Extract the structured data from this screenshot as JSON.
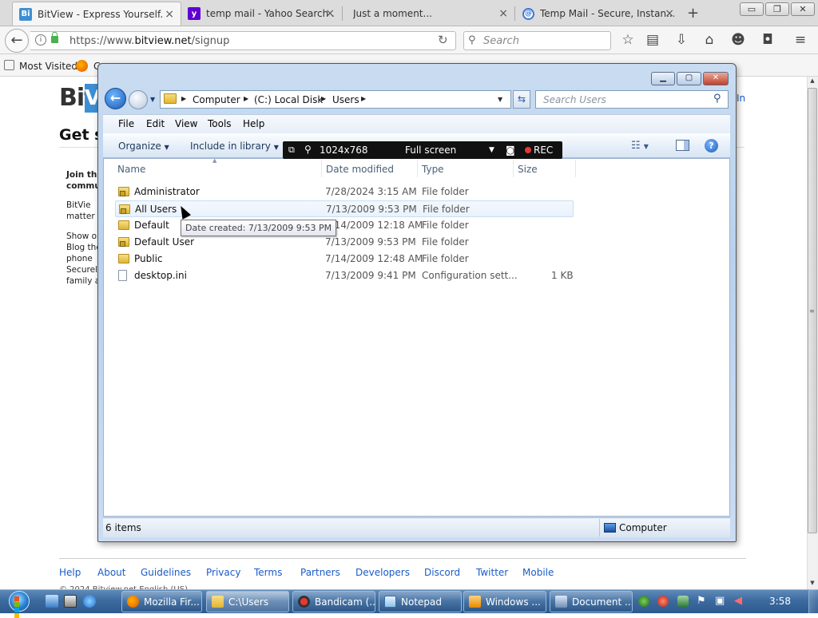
{
  "browser": {
    "tabs": [
      {
        "label": "BitView - Express Yourself.",
        "active": true
      },
      {
        "label": "temp mail - Yahoo Search ...",
        "active": false
      },
      {
        "label": "Just a moment...",
        "active": false
      },
      {
        "label": "Temp Mail - Secure, Instan...",
        "active": false
      }
    ],
    "url_prefix": "https://www.",
    "url_domain": "bitview.net",
    "url_path": "/signup",
    "search_placeholder": "Search",
    "bookmarks": {
      "most_visited": "Most Visited",
      "item2_partial": "G"
    },
    "tab_close_glyph": "×",
    "new_tab_glyph": "+"
  },
  "bitview": {
    "logo_text": "Bit",
    "logo_v": "V",
    "signin_partial": "In",
    "heading_partial": "Get s",
    "sidebar_lines": [
      "Join th",
      "commu",
      "BitVie",
      "matter t",
      "Show o",
      "Blog the",
      "phone",
      "Securel",
      "family a"
    ],
    "footer_links": [
      "Help",
      "About",
      "Guidelines",
      "Privacy",
      "Terms",
      "Partners",
      "Developers",
      "Discord",
      "Twitter",
      "Mobile"
    ],
    "copyright_partial": "© 2024 Bitview.net    English (US)"
  },
  "explorer": {
    "breadcrumbs": [
      "Computer",
      "(C:) Local Disk",
      "Users"
    ],
    "search_placeholder": "Search Users",
    "menu": [
      "File",
      "Edit",
      "View",
      "Tools",
      "Help"
    ],
    "commands": {
      "organize": "Organize",
      "include_in_library": "Include in library"
    },
    "columns": {
      "name": "Name",
      "date_modified": "Date modified",
      "type": "Type",
      "size": "Size"
    },
    "rows": [
      {
        "name": "Administrator",
        "date": "7/28/2024 3:15 AM",
        "type": "File folder",
        "size": "",
        "icon": "folder-lock-icon"
      },
      {
        "name": "All Users",
        "date": "7/13/2009 9:53 PM",
        "type": "File folder",
        "size": "",
        "icon": "folder-lock-icon",
        "hover": true
      },
      {
        "name": "Default",
        "date": "7/14/2009 12:18 AM",
        "type": "File folder",
        "size": "",
        "icon": "folder-icon"
      },
      {
        "name": "Default User",
        "date": "7/13/2009 9:53 PM",
        "type": "File folder",
        "size": "",
        "icon": "folder-lock-icon"
      },
      {
        "name": "Public",
        "date": "7/14/2009 12:48 AM",
        "type": "File folder",
        "size": "",
        "icon": "folder-icon"
      },
      {
        "name": "desktop.ini",
        "date": "7/13/2009 9:41 PM",
        "type": "Configuration sett...",
        "size": "1 KB",
        "icon": "file-icon"
      }
    ],
    "tooltip": "Date created: 7/13/2009 9:53 PM",
    "status_count": "6 items",
    "status_location": "Computer"
  },
  "bandicam": {
    "resolution": "1024x768",
    "mode": "Full screen",
    "rec": "REC"
  },
  "taskbar": {
    "items": [
      {
        "label": "Mozilla Fir...",
        "active": false,
        "icon_color": "#e8661c"
      },
      {
        "label": "C:\\Users",
        "active": true,
        "icon_color": "#e8c64a"
      },
      {
        "label": "Bandicam (...",
        "active": false,
        "icon_color": "#c62828"
      },
      {
        "label": "Notepad",
        "active": false,
        "icon_color": "#8ec1e8"
      },
      {
        "label": "Windows ...",
        "active": false,
        "icon_color": "#f0a030"
      },
      {
        "label": "Document ...",
        "active": false,
        "icon_color": "#6f8fb8"
      }
    ],
    "clock": "3:58"
  },
  "colors": {
    "accent_link": "#1a5cc8",
    "taskbar": "#3c6ba0",
    "explorer_frame": "#c9dcf1",
    "rec_dot": "#e53935"
  }
}
